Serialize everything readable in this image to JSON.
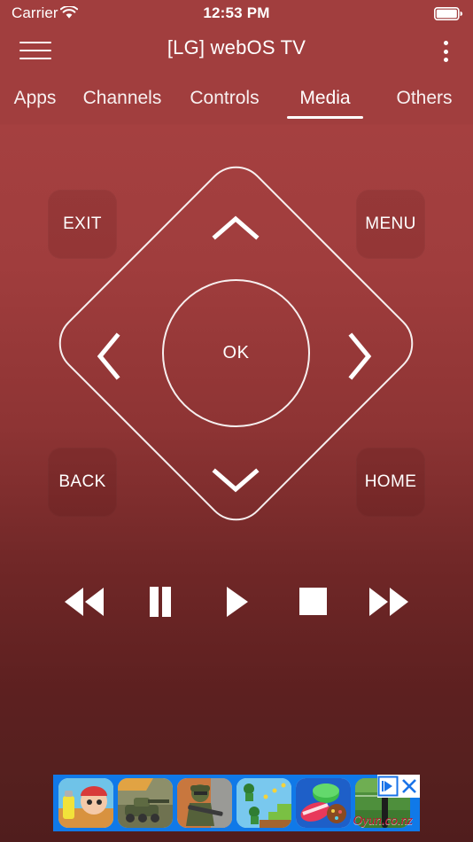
{
  "status_bar": {
    "carrier": "Carrier",
    "wifi_icon": "wifi-icon",
    "time": "12:53 PM",
    "battery_icon": "battery-full-icon"
  },
  "app_bar": {
    "menu_icon": "hamburger-menu-icon",
    "title": "[LG] webOS TV",
    "overflow_icon": "kebab-overflow-icon"
  },
  "tabs": {
    "items": [
      {
        "label": "Apps",
        "active": false
      },
      {
        "label": "Channels",
        "active": false
      },
      {
        "label": "Controls",
        "active": false
      },
      {
        "label": "Media",
        "active": true
      },
      {
        "label": "Others",
        "active": false
      }
    ],
    "active_index": 3
  },
  "dpad": {
    "ok_label": "OK",
    "up_icon": "chevron-up-icon",
    "down_icon": "chevron-down-icon",
    "left_icon": "chevron-left-icon",
    "right_icon": "chevron-right-icon",
    "corner_buttons": [
      {
        "label": "EXIT"
      },
      {
        "label": "MENU"
      },
      {
        "label": "BACK"
      },
      {
        "label": "HOME"
      }
    ]
  },
  "transport": {
    "buttons": [
      {
        "name": "rewind-button",
        "icon": "rewind-icon"
      },
      {
        "name": "pause-button",
        "icon": "pause-icon"
      },
      {
        "name": "play-button",
        "icon": "play-icon"
      },
      {
        "name": "stop-button",
        "icon": "stop-icon"
      },
      {
        "name": "fast-forward-button",
        "icon": "fast-forward-icon"
      }
    ]
  },
  "ad": {
    "brand": "Oyun.co.nz",
    "adchoices_icon": "adchoices-icon",
    "close_icon": "close-icon",
    "tiles": [
      {
        "name": "game-tile-subway"
      },
      {
        "name": "game-tile-tanks"
      },
      {
        "name": "game-tile-shooter"
      },
      {
        "name": "game-tile-platformer"
      },
      {
        "name": "game-tile-candy"
      },
      {
        "name": "game-tile-sports"
      }
    ]
  },
  "colors": {
    "header_red": "#a13e3e",
    "bg_dark_red": "#501d1d",
    "accent_white": "#ffffff",
    "ad_blue": "#1079e8",
    "ad_brand_red": "#c4122f"
  }
}
